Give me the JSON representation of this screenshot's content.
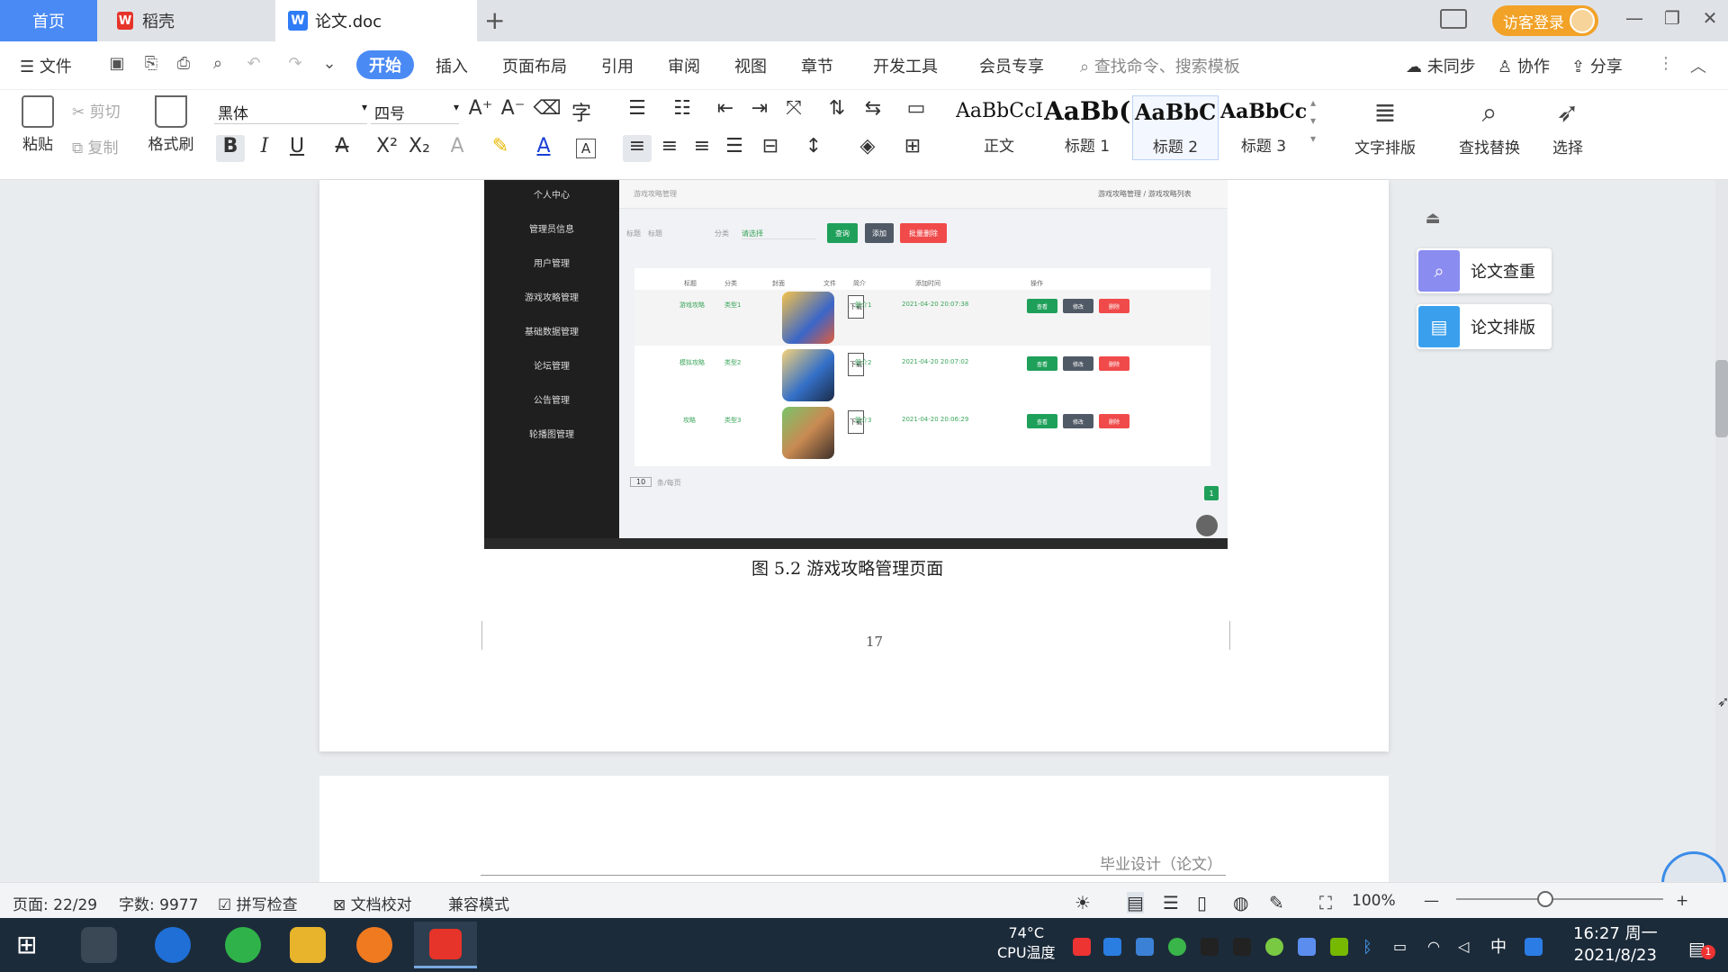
{
  "titlebar": {
    "tab_home": "首页",
    "tab_wps": "稻壳",
    "tab_doc": "论文.doc",
    "new_tab": "+",
    "login": "访客登录",
    "win_min": "—",
    "win_restore": "❐",
    "win_close": "✕"
  },
  "menubar": {
    "file": "文件",
    "items": [
      "开始",
      "插入",
      "页面布局",
      "引用",
      "审阅",
      "视图",
      "章节",
      "开发工具",
      "会员专享"
    ],
    "search": "查找命令、搜索模板",
    "sync": "未同步",
    "collab": "协作",
    "share": "分享"
  },
  "ribbon": {
    "paste": "粘贴",
    "cut": "剪切",
    "copy": "复制",
    "format_painter": "格式刷",
    "font_name": "黑体",
    "font_size": "四号",
    "styles": [
      {
        "sample": "AaBbCcI",
        "label": "正文"
      },
      {
        "sample": "AaBb(",
        "label": "标题 1"
      },
      {
        "sample": "AaBbC",
        "label": "标题 2"
      },
      {
        "sample": "AaBbCcl",
        "label": "标题 3"
      }
    ],
    "text_layout": "文字排版",
    "find_replace": "查找替换",
    "select": "选择"
  },
  "document": {
    "caption": "图 5.2  游戏攻略管理页面",
    "page_number": "17",
    "next_page_header": "毕业设计（论文）"
  },
  "screenshot": {
    "sidebar": [
      "个人中心",
      "管理员信息",
      "用户管理",
      "游戏攻略管理",
      "基础数据管理",
      "论坛管理",
      "公告管理",
      "轮播图管理"
    ],
    "top_title": "游戏攻略管理",
    "breadcrumb": "游戏攻略管理 / 游戏攻略列表",
    "search_label": "标题",
    "search_placeholder": "标题",
    "category_label": "分类",
    "category_placeholder": "请选择",
    "btn_query": "查询",
    "btn_add": "添加",
    "btn_batch_delete": "批量删除",
    "headers": [
      "标题",
      "分类",
      "封面",
      "文件",
      "简介",
      "添加时间",
      "操作"
    ],
    "rows": [
      {
        "title": "游戏攻略",
        "category": "类型1",
        "file": "下载",
        "intro": "简介1",
        "time": "2021-04-20 20:07:38"
      },
      {
        "title": "模拟攻略",
        "category": "类型2",
        "file": "下载",
        "intro": "简介2",
        "time": "2021-04-20 20:07:02"
      },
      {
        "title": "攻略",
        "category": "类型3",
        "file": "下载",
        "intro": "简介3",
        "time": "2021-04-20 20:06:29"
      }
    ],
    "actions": [
      "查看",
      "修改",
      "删除"
    ],
    "page_size": "10",
    "page_size_suffix": "条/每页",
    "page_current": "1"
  },
  "side_panel": {
    "check": "论文查重",
    "layout": "论文排版"
  },
  "statusbar": {
    "page": "页面: 22/29",
    "words": "字数: 9977",
    "spell": "拼写检查",
    "proof": "文档校对",
    "compat": "兼容模式",
    "zoom": "100%",
    "zoom_minus": "—",
    "zoom_plus": "+"
  },
  "taskbar": {
    "cpu_temp": "74°C",
    "cpu_label": "CPU温度",
    "ime": "中",
    "time": "16:27 周一",
    "date": "2021/8/23",
    "notifications": "1"
  },
  "colors": {
    "accent": "#4a8af4",
    "login": "#f2a227",
    "btn_green": "#1fa05a",
    "btn_dark": "#505a66",
    "btn_red": "#f04a4a"
  }
}
